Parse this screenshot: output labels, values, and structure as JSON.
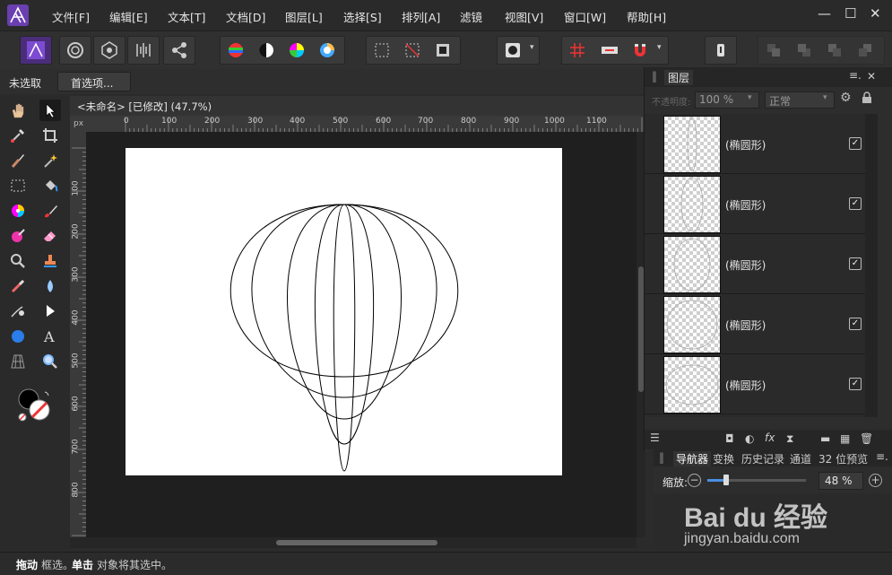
{
  "menu": [
    "文件[F]",
    "编辑[E]",
    "文本[T]",
    "文档[D]",
    "图层[L]",
    "选择[S]",
    "排列[A]",
    "滤镜",
    "视图[V]",
    "窗口[W]",
    "帮助[H]"
  ],
  "window_controls": {
    "minimize": "—",
    "maximize": "☐",
    "close": "✕"
  },
  "context": {
    "selection": "未选取",
    "prefs": "首选项..."
  },
  "doc_tab": "<未命名> [已修改] (47.7%)",
  "ruler": {
    "unit": "px",
    "h_ticks": [
      "0",
      "100",
      "200",
      "300",
      "400",
      "500",
      "600",
      "700",
      "800",
      "900",
      "1000",
      "1100"
    ],
    "v_ticks": [
      "100",
      "200",
      "300",
      "400",
      "500",
      "600",
      "700",
      "800"
    ]
  },
  "layers_panel": {
    "title": "图层",
    "opacity_label": "不透明度:",
    "opacity_value": "100 %",
    "blend_mode": "正常",
    "layers": [
      {
        "name": "(椭圆形)",
        "visible": true
      },
      {
        "name": "(椭圆形)",
        "visible": true
      },
      {
        "name": "(椭圆形)",
        "visible": true
      },
      {
        "name": "(椭圆形)",
        "visible": true
      },
      {
        "name": "(椭圆形)",
        "visible": true
      }
    ]
  },
  "nav_tabs": [
    "导航器",
    "变换",
    "历史记录",
    "通道",
    "32 位预览"
  ],
  "zoom": {
    "label": "缩放:",
    "value": "48 %"
  },
  "watermark": {
    "brand": "Bai du 经验",
    "url": "jingyan.baidu.com"
  },
  "status": {
    "drag_key": "拖动",
    "drag_text": "框选。",
    "click_key": "单击",
    "click_text": "对象将其选中。"
  },
  "colors": {
    "accent": "#6a3fb0",
    "bg": "#2b2b2b",
    "canvas": "#1f1f1f"
  }
}
